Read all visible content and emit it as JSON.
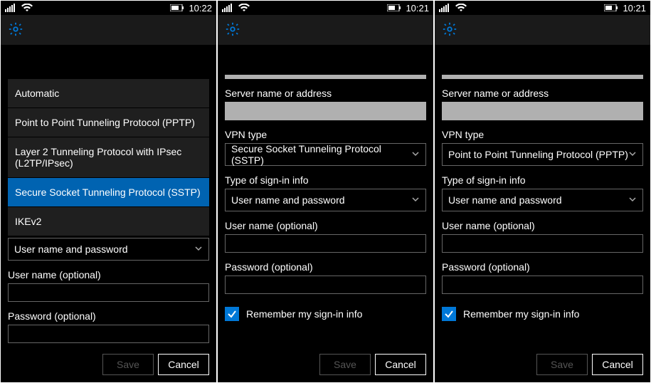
{
  "common": {
    "labels": {
      "server": "Server name or address",
      "vpn_type": "VPN type",
      "signin_type": "Type of sign-in info",
      "username": "User name (optional)",
      "password": "Password (optional)",
      "remember": "Remember my sign-in info",
      "save": "Save",
      "cancel": "Cancel"
    },
    "signin_value": "User name and password",
    "remember_checked": true,
    "save_enabled": false
  },
  "vpn_type_options": [
    "Automatic",
    "Point to Point Tunneling Protocol (PPTP)",
    "Layer 2 Tunneling Protocol with IPsec (L2TP/IPsec)",
    "Secure Socket Tunneling Protocol (SSTP)",
    "IKEv2"
  ],
  "screens": [
    {
      "time": "10:22",
      "dropdown_open": true,
      "dropdown_selected_index": 3
    },
    {
      "time": "10:21",
      "vpn_type_value": "Secure Socket Tunneling Protocol (SSTP)"
    },
    {
      "time": "10:21",
      "vpn_type_value": "Point to Point Tunneling Protocol (PPTP)"
    }
  ]
}
